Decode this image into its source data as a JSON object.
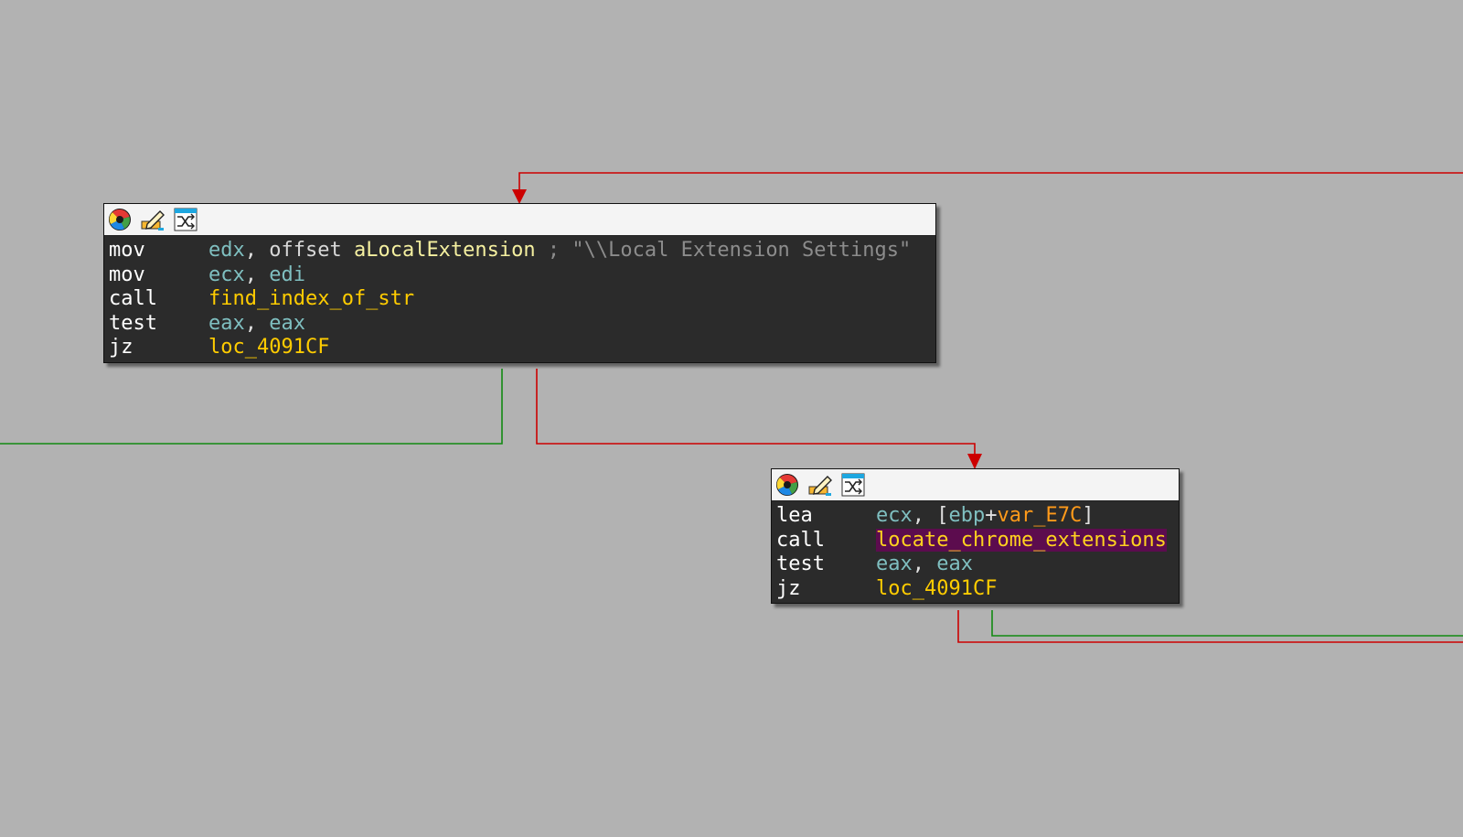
{
  "block1": {
    "header_icons": [
      "color-wheel-icon",
      "edit-pencil-icon",
      "graph-shuffle-icon"
    ],
    "lines": [
      {
        "mnemonic": "mov",
        "op1": "edx",
        "sep": ", ",
        "op2_kw": "offset ",
        "op2": "aLocalExtension",
        "comment": " ; \"\\\\Local Extension Settings\""
      },
      {
        "mnemonic": "mov",
        "op1": "ecx",
        "sep": ", ",
        "op2": "edi"
      },
      {
        "mnemonic": "call",
        "op1": "find_index_of_str"
      },
      {
        "mnemonic": "test",
        "op1": "eax",
        "sep": ", ",
        "op2": "eax"
      },
      {
        "mnemonic": "jz",
        "op1": "loc_4091CF"
      }
    ]
  },
  "block2": {
    "header_icons": [
      "color-wheel-icon",
      "edit-pencil-icon",
      "graph-shuffle-icon"
    ],
    "lines": [
      {
        "mnemonic": "lea",
        "op1": "ecx",
        "sep": ", ",
        "open": "[",
        "base": "ebp",
        "plus": "+",
        "var": "var_E7C",
        "close": "]"
      },
      {
        "mnemonic": "call",
        "op1": "locate_chrome_extensions"
      },
      {
        "mnemonic": "test",
        "op1": "eax",
        "sep": ", ",
        "op2": "eax"
      },
      {
        "mnemonic": "jz",
        "op1": "loc_4091CF"
      }
    ]
  },
  "colors": {
    "background": "#b2b2b2",
    "edge_false": "#cc0000",
    "edge_true": "#138a13",
    "register": "#7fbfc0",
    "function": "#ffcc00",
    "highlight": "#5c0c4e"
  }
}
